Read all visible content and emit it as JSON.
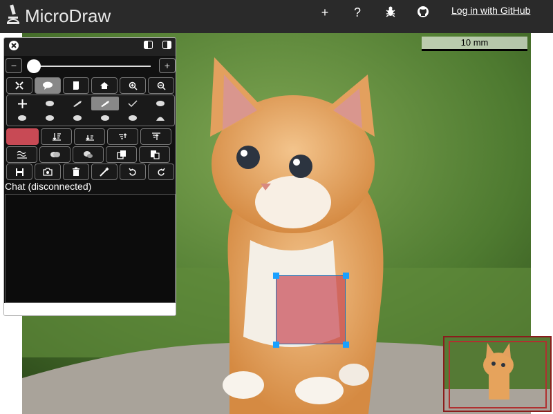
{
  "app": {
    "title": "MicroDraw",
    "login_label": "Log in with GitHub",
    "top_icons": [
      "add-icon",
      "help-icon",
      "bug-icon",
      "github-icon"
    ],
    "top_icon_glyphs": [
      "+",
      "?",
      "✱",
      "●"
    ]
  },
  "canvas": {
    "scalebar_label": "10 mm",
    "region_color": "#c84a55"
  },
  "panel": {
    "zoom_minus": "−",
    "zoom_plus": "+",
    "zoom_level": 0.04,
    "chat_label": "Chat (disconnected)",
    "chat_placeholder": ""
  },
  "colors": {
    "topbar": "#2a2a2a",
    "region_fill": "#c84a55",
    "region_border": "#2a6fb0",
    "handles": "#19a0ff",
    "navigator_border": "#8a1c1c"
  }
}
